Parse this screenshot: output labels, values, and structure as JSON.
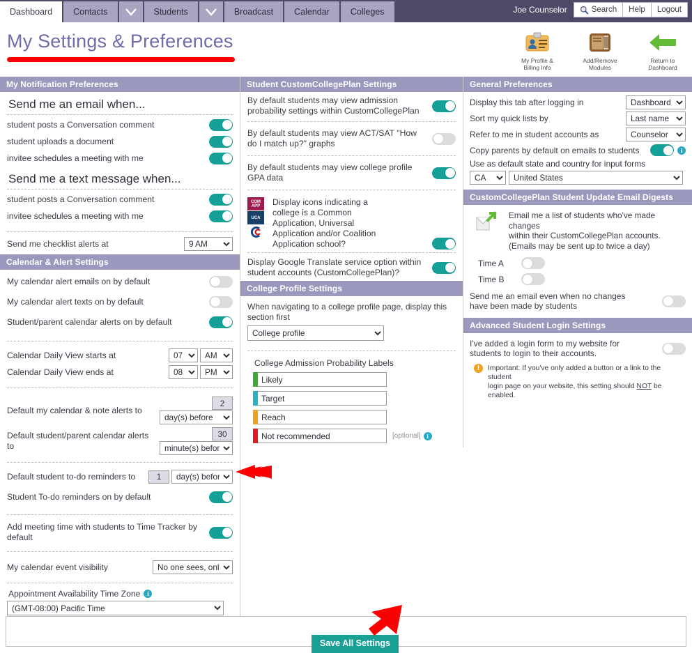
{
  "nav": {
    "tabs": [
      {
        "label": "Dashboard",
        "active": true,
        "type": "tab"
      },
      {
        "label": "Contacts",
        "active": false,
        "type": "tab"
      },
      {
        "label": "",
        "active": false,
        "type": "caret"
      },
      {
        "label": "Students",
        "active": false,
        "type": "tab"
      },
      {
        "label": "",
        "active": false,
        "type": "caret"
      },
      {
        "label": "Broadcast",
        "active": false,
        "type": "tab"
      },
      {
        "label": "Calendar",
        "active": false,
        "type": "tab"
      },
      {
        "label": "Colleges",
        "active": false,
        "type": "tab"
      }
    ],
    "username": "Joe Counselor",
    "search_label": "Search",
    "help_label": "Help",
    "logout_label": "Logout"
  },
  "page": {
    "title": "My Settings & Preferences"
  },
  "header_icons": [
    {
      "name": "my-profile-billing-info",
      "line1": "My Profile &",
      "line2": "Billing Info"
    },
    {
      "name": "add-remove-modules",
      "line1": "Add/Remove",
      "line2": "Modules"
    },
    {
      "name": "return-to-dashboard",
      "line1": "Return to",
      "line2": "Dashboard"
    }
  ],
  "notification_prefs": {
    "header": "My Notification Preferences",
    "email_heading": "Send me an email when...",
    "email_items": [
      {
        "label": "student posts a Conversation comment",
        "on": true
      },
      {
        "label": "student uploads a document",
        "on": true
      },
      {
        "label": "invitee schedules a meeting with me",
        "on": true
      }
    ],
    "text_heading": "Send me a text message when...",
    "text_items": [
      {
        "label": "student posts a Conversation comment",
        "on": true
      },
      {
        "label": "invitee schedules a meeting with me",
        "on": true
      }
    ],
    "checklist_label": "Send me checklist alerts at",
    "checklist_value": "9 AM"
  },
  "calendar_settings": {
    "header": "Calendar & Alert Settings",
    "toggles": [
      {
        "label": "My calendar alert emails on by default",
        "on": false
      },
      {
        "label": "My calendar alert texts on by default",
        "on": false
      },
      {
        "label": "Student/parent calendar alerts on by default",
        "on": true
      }
    ],
    "daily_start_label": "Calendar Daily View starts at",
    "daily_start_hour": "07",
    "daily_start_ampm": "AM",
    "daily_end_label": "Calendar Daily View ends at",
    "daily_end_hour": "08",
    "daily_end_ampm": "PM",
    "my_alert_label": "Default my calendar & note alerts to",
    "my_alert_num": "2",
    "my_alert_unit": "day(s) before",
    "sp_alert_label": "Default student/parent calendar alerts to",
    "sp_alert_num": "30",
    "sp_alert_unit": "minute(s) before",
    "todo_label": "Default student to-do reminders to",
    "todo_num": "1",
    "todo_unit": "day(s) before",
    "todo_toggle_label": "Student To-do reminders on by default",
    "todo_toggle_on": true,
    "timetracker_label": "Add meeting time with students to Time Tracker by default",
    "timetracker_on": true,
    "visibility_label": "My calendar event visibility",
    "visibility_value": "No one sees, only me",
    "timezone_label": "Appointment Availability Time Zone",
    "timezone_value": "(GMT-08:00) Pacific Time"
  },
  "ccp_settings": {
    "header": "Student CustomCollegePlan Settings",
    "items": [
      {
        "label": "By default students may view admission probability settings within CustomCollegePlan",
        "on": true
      },
      {
        "label": "By default students may view ACT/SAT \"How do I match up?\" graphs",
        "on": false
      },
      {
        "label": "By default students may view college profile GPA data",
        "on": true
      }
    ],
    "app_icons_label": "Display icons indicating a college is a Common Application, Universal Application and/or Coalition Application school?",
    "app_icons_on": true,
    "app_logos": [
      {
        "name": "common-app-logo",
        "text": "COM APP",
        "color": "#9e1b4f"
      },
      {
        "name": "universal-app-logo",
        "text": "UCA",
        "color": "#1b3f6b"
      },
      {
        "name": "coalition-app-logo",
        "text": "C",
        "color": "#ffffff"
      }
    ],
    "translate_label": "Display Google Translate service option within student accounts (CustomCollegePlan)?",
    "translate_on": true
  },
  "college_profile": {
    "header": "College Profile Settings",
    "nav_label": "When navigating to a college profile page, display this section first",
    "nav_value": "College profile",
    "prob_title": "College Admission Probability Labels",
    "prob_labels": [
      {
        "value": "Likely",
        "color": "#3eaa35"
      },
      {
        "value": "Target",
        "color": "#29b2c6"
      },
      {
        "value": "Reach",
        "color": "#f2a11c"
      },
      {
        "value": "Not recommended",
        "color": "#e01b22"
      }
    ],
    "optional_text": "[optional]"
  },
  "general_prefs": {
    "header": "General Preferences",
    "rows": [
      {
        "label": "Display this tab after logging in",
        "value": "Dashboard"
      },
      {
        "label": "Sort my quick lists by",
        "value": "Last name"
      },
      {
        "label": "Refer to me in student accounts as",
        "value": "Counselor"
      }
    ],
    "copy_parents_label": "Copy parents by default on emails to students",
    "copy_parents_on": true,
    "default_state_label": "Use as default state and country for input forms",
    "state_value": "CA",
    "country_value": "United States"
  },
  "email_digests": {
    "header": "CustomCollegePlan Student Update Email Digests",
    "description_line1": "Email me a list of students who've made changes",
    "description_line2": "within their CustomCollegePlan accounts.",
    "description_line3": "(Emails may be sent up to twice a day)",
    "time_a_label": "Time A",
    "time_a_on": false,
    "time_b_label": "Time B",
    "time_b_on": false,
    "no_changes_label": "Send me an email even when no changes have been made by students",
    "no_changes_on": false
  },
  "advanced_login": {
    "header": "Advanced Student Login Settings",
    "toggle_label": "I've added a login form to my website for students to login to their accounts.",
    "toggle_on": false,
    "note_line1": "Important: If you've only added a button or a link to the student",
    "note_line2_a": "login page on your website, this setting should ",
    "note_line2_b": "NOT",
    "note_line2_c": " be enabled."
  },
  "footer": {
    "save_label": "Save All Settings"
  },
  "colors": {
    "nav_bg": "#4c4a66",
    "tab_bg": "#a8a5c2",
    "section_header": "#9b98bd",
    "toggle_on": "#14a098",
    "toggle_off": "#dcdcdc",
    "title": "#6d6ea8",
    "accent_red": "#fb0000",
    "save_button": "#19a094"
  }
}
